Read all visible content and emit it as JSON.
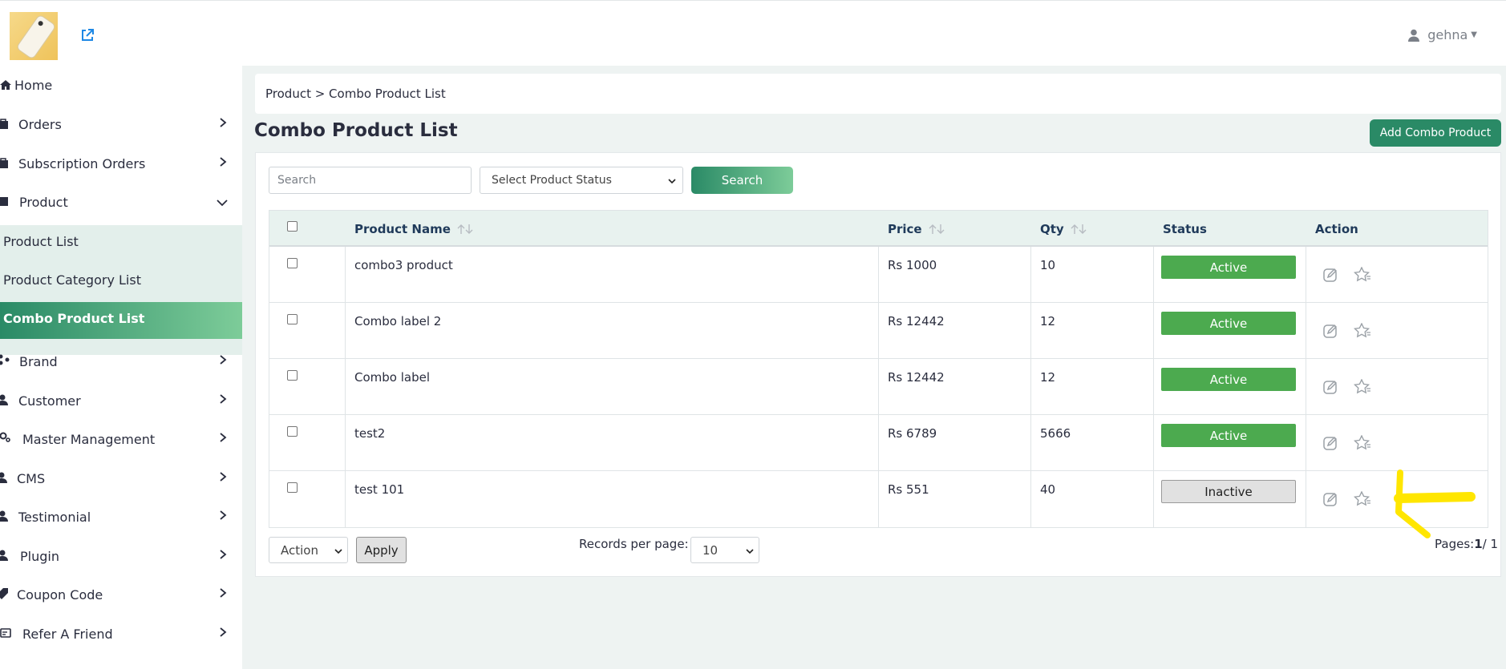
{
  "header": {
    "username": "gehna",
    "icons": [
      "external-link-icon",
      "user-icon",
      "caret-down-icon"
    ]
  },
  "sidebar": {
    "items": [
      {
        "label": "Home",
        "icon": "home-icon"
      },
      {
        "label": "Orders",
        "icon": "bag-icon"
      },
      {
        "label": "Subscription Orders",
        "icon": "bag-icon"
      },
      {
        "label": "Product",
        "icon": "box-icon",
        "expanded": true
      },
      {
        "label": "Brand",
        "icon": "brand-icon"
      },
      {
        "label": "Customer",
        "icon": "user-icon"
      },
      {
        "label": "Master Management",
        "icon": "gears-icon"
      },
      {
        "label": "CMS",
        "icon": "user-icon"
      },
      {
        "label": "Testimonial",
        "icon": "user-icon"
      },
      {
        "label": "Plugin",
        "icon": "plug-icon"
      },
      {
        "label": "Coupon Code",
        "icon": "tag-icon"
      },
      {
        "label": "Refer A Friend",
        "icon": "card-icon"
      }
    ],
    "sub_items": [
      {
        "label": "Product List"
      },
      {
        "label": "Product Category List"
      },
      {
        "label": "Combo Product List",
        "active": true
      }
    ],
    "active_color": "#2a8a66"
  },
  "breadcrumb": "Product > Combo Product List",
  "page": {
    "title": "Combo Product List",
    "add_button": "Add Combo Product"
  },
  "filters": {
    "search_placeholder": "Search",
    "status_select": "Select Product Status",
    "search_button": "Search"
  },
  "table": {
    "columns": [
      "Product Name",
      "Price",
      "Qty",
      "Status",
      "Action"
    ],
    "rows": [
      {
        "name": "combo3 product",
        "price": "Rs 1000",
        "qty": "10",
        "status": "Active"
      },
      {
        "name": "Combo label 2",
        "price": "Rs 12442",
        "qty": "12",
        "status": "Active"
      },
      {
        "name": "Combo label",
        "price": "Rs 12442",
        "qty": "12",
        "status": "Active"
      },
      {
        "name": "test2",
        "price": "Rs 6789",
        "qty": "5666",
        "status": "Active"
      },
      {
        "name": "test 101",
        "price": "Rs 551",
        "qty": "40",
        "status": "Inactive"
      }
    ]
  },
  "footer": {
    "action_select": "Action",
    "apply_button": "Apply",
    "records_label": "Records per page:",
    "records_value": "10",
    "pages_label": "Pages:",
    "pages_current": "1",
    "pages_total": "/ 1"
  },
  "colors": {
    "brand_green": "#2a8a66",
    "active_badge": "#4caa4f",
    "annotation": "#ffe600"
  }
}
